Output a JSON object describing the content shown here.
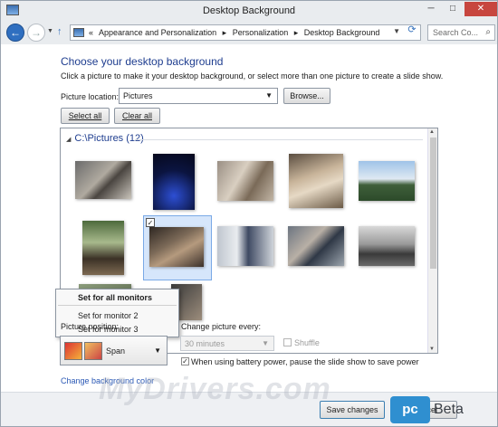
{
  "window": {
    "title": "Desktop Background",
    "controls": {
      "minimize": "─",
      "maximize": "□",
      "close": "✕"
    }
  },
  "nav": {
    "back_icon": "back-arrow-icon",
    "forward_icon": "forward-arrow-icon",
    "recent_marker": "▼",
    "up_icon": "up-arrow-icon",
    "breadcrumb": [
      "«",
      "Appearance and Personalization",
      "▸",
      "Personalization",
      "▸",
      "Desktop Background"
    ],
    "address_dropdown": "▼",
    "refresh_icon": "refresh-icon",
    "search_placeholder": "Search Co...",
    "search_icon": "search-icon"
  },
  "main": {
    "heading": "Choose your desktop background",
    "subtitle": "Click a picture to make it your desktop background, or select more than one picture to create a slide show.",
    "picture_location": {
      "label": "Picture location:",
      "value": "Pictures"
    },
    "browse_label": "Browse...",
    "select_all_label": "Select all",
    "clear_all_label": "Clear all",
    "group_title": "C:\\Pictures (12)",
    "pictures": [
      {
        "subject": "dog-lying-on-rug",
        "selected": false
      },
      {
        "subject": "eiffel-tower-night",
        "selected": false
      },
      {
        "subject": "puppy-on-blanket",
        "selected": false
      },
      {
        "subject": "puppy-with-toy",
        "selected": false
      },
      {
        "subject": "city-skyline",
        "selected": false
      },
      {
        "subject": "person-outdoors",
        "selected": false
      },
      {
        "subject": "person-on-couch",
        "selected": true
      },
      {
        "subject": "child-on-steps",
        "selected": false
      },
      {
        "subject": "person-with-baby",
        "selected": false
      },
      {
        "subject": "city-black-and-white",
        "selected": false
      },
      {
        "subject": "partial-bottom-left",
        "selected": false
      },
      {
        "subject": "partial-bottom-middle",
        "selected": false
      }
    ],
    "context_menu": [
      "Set for all monitors",
      "Set for monitor 2",
      "Set for monitor 3"
    ],
    "picture_position": {
      "label": "Picture position:",
      "value": "Span"
    },
    "change_every": {
      "label": "Change picture every:",
      "value": "30 minutes"
    },
    "shuffle_label": "Shuffle",
    "shuffle_checked": false,
    "battery_label": "When using battery power, pause the slide show to save power",
    "battery_checked": true,
    "color_link": "Change background color"
  },
  "footer": {
    "save_label": "Save changes",
    "cancel_label": "Cancel"
  },
  "watermark": {
    "text": "MyDrivers.com",
    "badge": "pc",
    "badge_text": "Beta"
  }
}
